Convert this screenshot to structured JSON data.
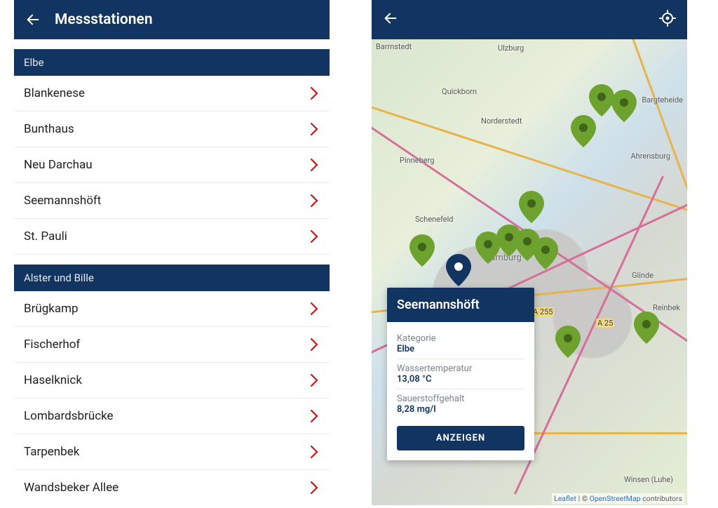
{
  "left": {
    "title": "Messstationen",
    "sections": [
      {
        "label": "Elbe",
        "items": [
          "Blankenese",
          "Bunthaus",
          "Neu Darchau",
          "Seemannshöft",
          "St. Pauli"
        ]
      },
      {
        "label": "Alster und Bille",
        "items": [
          "Brügkamp",
          "Fischerhof",
          "Haselknick",
          "Lombardsbrücke",
          "Tarpenbek",
          "Wandsbeker Allee"
        ]
      }
    ]
  },
  "right": {
    "labels": {
      "barmstedt": "Barmstedt",
      "ulzburg": "Ulzburg",
      "quickborn": "Quickborn",
      "norderstedt": "Norderstedt",
      "bargteheide": "Bargteheide",
      "ahrensburg": "Ahrensburg",
      "pinneberg": "Pinneberg",
      "schenefeld": "Schenefeld",
      "hamburg": "Hamburg",
      "glinde": "Glinde",
      "reinbek": "Reinbek",
      "a255": "A 255",
      "a25": "A 25",
      "winsen": "Winsen (Luhe)"
    },
    "popup": {
      "title": "Seemannshöft",
      "fields": [
        {
          "label": "Kategorie",
          "value": "Elbe"
        },
        {
          "label": "Wassertemperatur",
          "value": "13,08 °C"
        },
        {
          "label": "Sauerstoffgehalt",
          "value": "8,28 mg/l"
        }
      ],
      "button": "ANZEIGEN"
    },
    "attribution": {
      "leaflet": "Leaflet",
      "sep": " | © ",
      "osm": "OpenStreetMap",
      "tail": " contributors"
    }
  }
}
